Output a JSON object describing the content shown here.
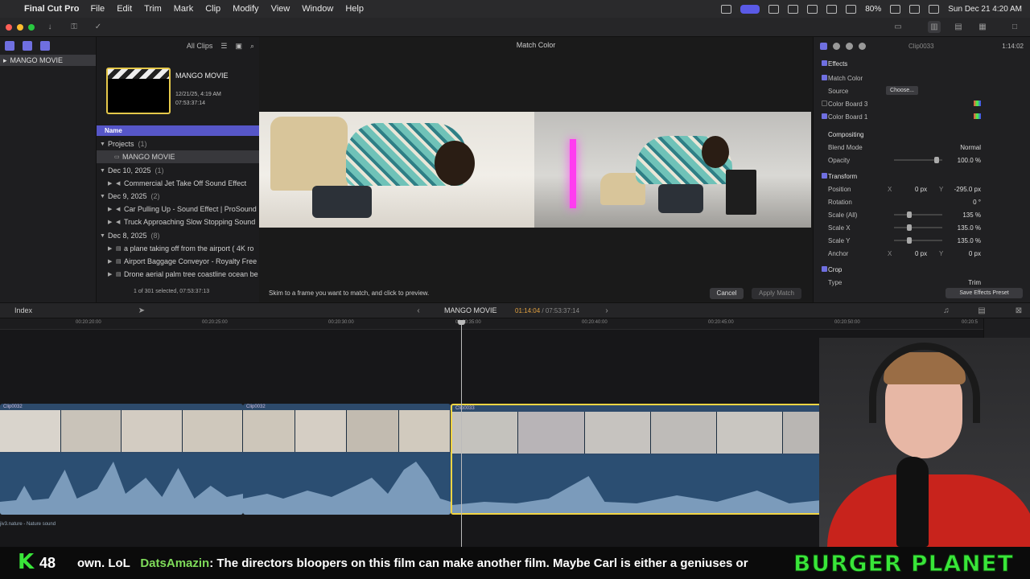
{
  "menubar": {
    "app": "Final Cut Pro",
    "items": [
      "File",
      "Edit",
      "Trim",
      "Mark",
      "Clip",
      "Modify",
      "View",
      "Window",
      "Help"
    ],
    "battery": "80%",
    "clock": "Sun Dec 21  4:20 AM"
  },
  "libraries": {
    "library_name": "MANGO MOVIE"
  },
  "browser": {
    "filter": "All Clips",
    "project_thumb": {
      "title": "MANGO MOVIE",
      "date": "12/21/25, 4:19 AM",
      "duration": "07:53:37:14"
    },
    "column_header": "Name",
    "rows": [
      {
        "label": "Projects",
        "count": "(1)",
        "kind": "group"
      },
      {
        "label": "MANGO MOVIE",
        "count": "",
        "kind": "project"
      },
      {
        "label": "Dec 10, 2025",
        "count": "(1)",
        "kind": "group"
      },
      {
        "label": "Commercial Jet Take Off Sound Effect",
        "count": "",
        "kind": "clip"
      },
      {
        "label": "Dec 9, 2025",
        "count": "(2)",
        "kind": "group"
      },
      {
        "label": "Car Pulling Up - Sound Effect  |  ProSound",
        "count": "",
        "kind": "clip"
      },
      {
        "label": "Truck Approaching Slow Stopping Sound",
        "count": "",
        "kind": "clip"
      },
      {
        "label": "Dec 8, 2025",
        "count": "(8)",
        "kind": "group"
      },
      {
        "label": "a plane taking off from the airport ( 4K ro",
        "count": "",
        "kind": "clip"
      },
      {
        "label": "Airport Baggage Conveyor - Royalty Free",
        "count": "",
        "kind": "clip"
      },
      {
        "label": "Drone aerial palm tree coastline ocean be",
        "count": "",
        "kind": "clip"
      }
    ],
    "selection_status": "1 of 301 selected, 07:53:37:13"
  },
  "viewer": {
    "title": "Match Color",
    "message": "Skim to a frame you want to match, and click to preview.",
    "cancel": "Cancel",
    "apply": "Apply Match"
  },
  "inspector": {
    "clip_name": "Clip0033",
    "duration": "1:14:02",
    "rows": {
      "effects": "Effects",
      "match_color": "Match Color",
      "source": "Source",
      "choose": "Choose...",
      "color_board_3": "Color Board 3",
      "color_board_1": "Color Board 1",
      "compositing": "Compositing",
      "blend_mode": "Blend Mode",
      "blend_mode_val": "Normal",
      "opacity": "Opacity",
      "opacity_val": "100.0 %",
      "transform": "Transform",
      "position": "Position",
      "position_x": "0 px",
      "position_y": "-295.0 px",
      "rotation": "Rotation",
      "rotation_val": "0 °",
      "scale_all": "Scale (All)",
      "scale_all_val": "135 %",
      "scale_x": "Scale X",
      "scale_x_val": "135.0 %",
      "scale_y": "Scale Y",
      "scale_y_val": "135.0 %",
      "anchor": "Anchor",
      "anchor_x": "0 px",
      "anchor_y": "0 px",
      "crop": "Crop",
      "type": "Type",
      "type_val": "Trim"
    },
    "save_preset": "Save Effects Preset"
  },
  "timeline": {
    "index": "Index",
    "project": "MANGO MOVIE",
    "timecode_current": "01:14:04",
    "timecode_total": "07:53:37:14",
    "ruler": [
      "00:20:20:00",
      "00:20:25:00",
      "00:20:30:00",
      "00:20:35:00",
      "00:20:40:00",
      "00:20:45:00",
      "00:20:50:00",
      "00:20:5"
    ],
    "clips": [
      "Clip0032",
      "Clip0032",
      "Clip0033"
    ],
    "audio_lane": "jiv3.nature - Nature sound"
  },
  "ticker": {
    "k": "K",
    "count": "48",
    "prefix": "own. LoL",
    "user": "DatsAmazin",
    "message": ": The directors bloopers on this film can make another film. Maybe Carl is either a geniuses or",
    "brand": "BURGER PLANET"
  },
  "colors": {
    "accent": "#5656c8",
    "selection_yellow": "#f2d544",
    "clip_blue": "#2d4a6b",
    "ticker_green": "#39e639"
  }
}
